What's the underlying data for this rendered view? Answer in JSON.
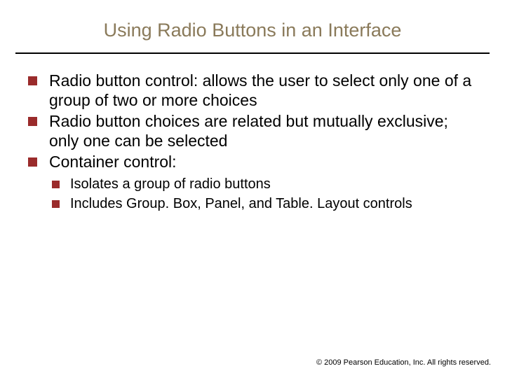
{
  "title": "Using Radio Buttons in an Interface",
  "bullets": [
    {
      "text": "Radio button control: allows the user to select only one of a group of two or more choices"
    },
    {
      "text": "Radio button choices are related but mutually exclusive; only one can be selected"
    },
    {
      "text": "Container control:"
    }
  ],
  "sub_bullets": [
    {
      "text": "Isolates a group of radio buttons"
    },
    {
      "text": "Includes Group. Box, Panel, and Table. Layout controls"
    }
  ],
  "copyright": "© 2009 Pearson Education, Inc. All rights reserved."
}
